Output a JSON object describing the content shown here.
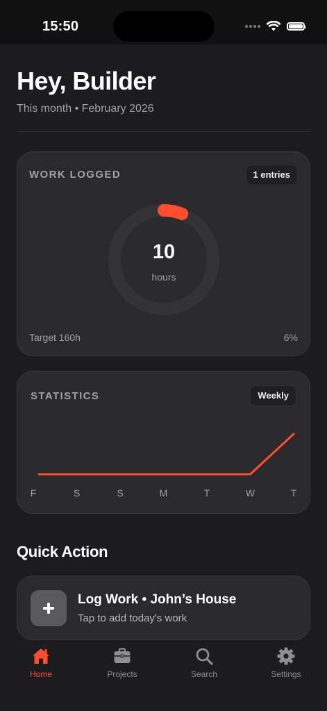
{
  "status_bar": {
    "time": "15:50"
  },
  "header": {
    "greeting": "Hey, Builder",
    "subtitle": "This month • February 2026"
  },
  "work_card": {
    "title": "WORK LOGGED",
    "entries_badge": "1 entries",
    "hours_value": "10",
    "hours_unit": "hours",
    "target_label": "Target 160h",
    "percent_label": "6%",
    "progress_fraction": 0.06,
    "accent_color": "#ff4d30"
  },
  "stats_card": {
    "title": "STATISTICS",
    "period_badge": "Weekly"
  },
  "chart_data": {
    "type": "line",
    "categories": [
      "F",
      "S",
      "S",
      "M",
      "T",
      "W",
      "T"
    ],
    "series": [
      {
        "values": [
          0,
          0,
          0,
          0,
          0,
          0,
          10
        ]
      }
    ],
    "title": "",
    "xlabel": "",
    "ylabel": "",
    "ylim": [
      0,
      10
    ],
    "grid": false,
    "color": "#ff4d30"
  },
  "quick_action": {
    "section_title": "Quick Action",
    "title": "Log Work • John’s House",
    "subtitle": "Tap to add today's work",
    "icon": "plus-icon"
  },
  "tab_bar": {
    "items": [
      {
        "label": "Home",
        "icon": "home-icon",
        "active": true
      },
      {
        "label": "Projects",
        "icon": "briefcase-icon",
        "active": false
      },
      {
        "label": "Search",
        "icon": "search-icon",
        "active": false
      },
      {
        "label": "Settings",
        "icon": "gear-icon",
        "active": false
      }
    ]
  }
}
